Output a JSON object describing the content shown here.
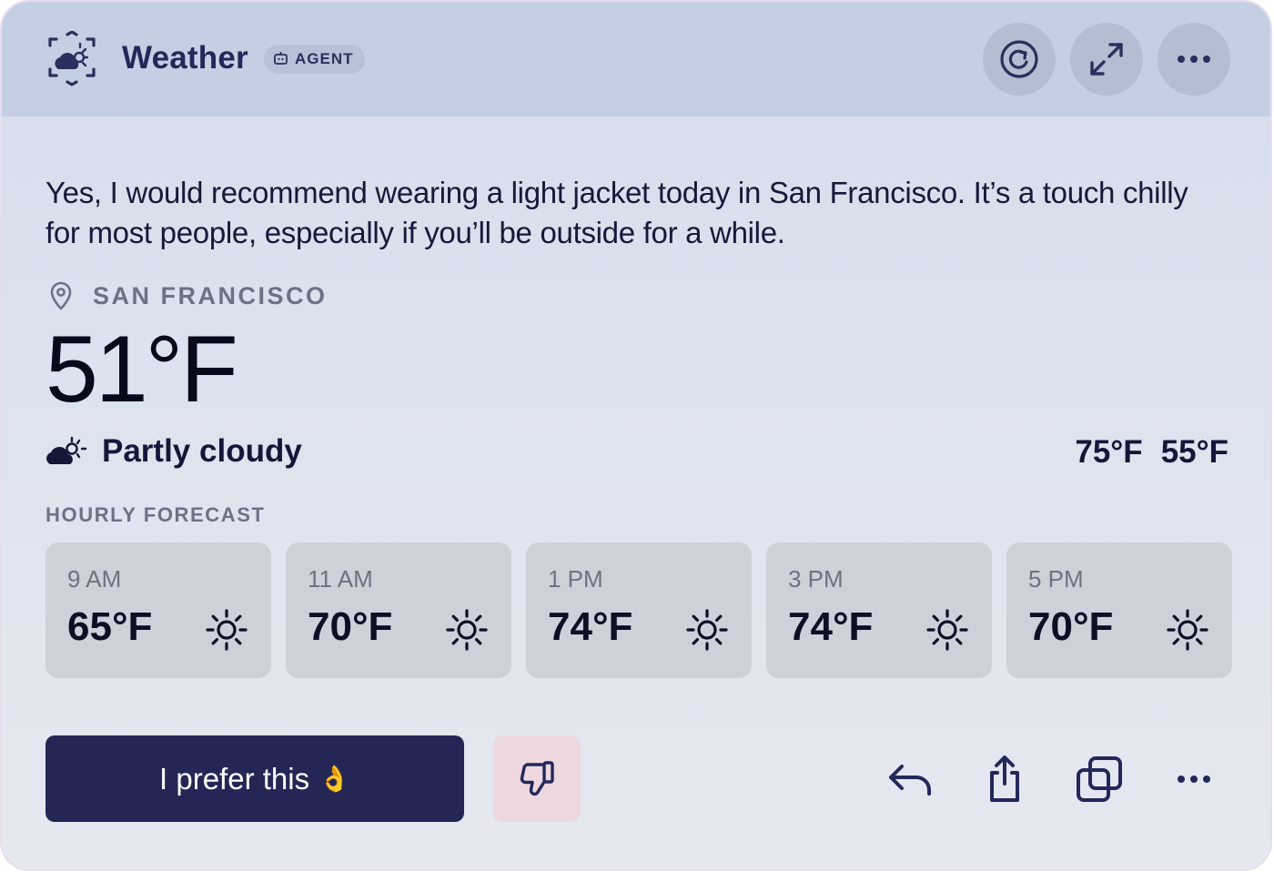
{
  "header": {
    "title": "Weather",
    "badge": "AGENT",
    "buttons": {
      "refresh": "refresh-icon",
      "expand": "expand-icon",
      "more": "more-icon"
    }
  },
  "message": "Yes, I would recommend wearing a light jacket today in San Francisco. It’s a touch chilly for most people, especially if you’ll be outside for a while.",
  "location": "SAN FRANCISCO",
  "current": {
    "temp": "51°F",
    "condition": "Partly cloudy",
    "high": "75°F",
    "low": "55°F"
  },
  "hourly": {
    "label": "HOURLY FORECAST",
    "items": [
      {
        "time": "9 AM",
        "temp": "65°F",
        "icon": "sun-icon"
      },
      {
        "time": "11 AM",
        "temp": "70°F",
        "icon": "sun-icon"
      },
      {
        "time": "1 PM",
        "temp": "74°F",
        "icon": "sun-icon"
      },
      {
        "time": "3 PM",
        "temp": "74°F",
        "icon": "sun-icon"
      },
      {
        "time": "5 PM",
        "temp": "70°F",
        "icon": "sun-icon"
      }
    ]
  },
  "actions": {
    "prefer_label": "I prefer this",
    "prefer_emoji": "👌",
    "icons": [
      "thumbs-down-icon",
      "reply-icon",
      "share-icon",
      "copy-icon",
      "more-icon"
    ]
  },
  "colors": {
    "navy": "#242755",
    "header_bg": "#c4cfe3",
    "tile_bg": "#cdd1da",
    "dislike_bg": "#ecd8de"
  }
}
